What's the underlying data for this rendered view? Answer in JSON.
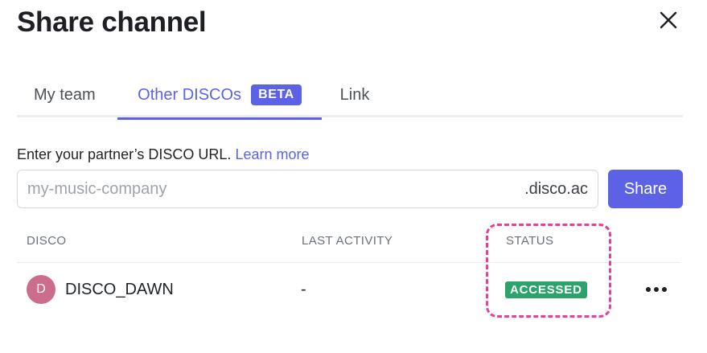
{
  "modal": {
    "title": "Share channel"
  },
  "tabs": [
    {
      "label": "My team",
      "active": false
    },
    {
      "label": "Other DISCOs",
      "badge": "BETA",
      "active": true
    },
    {
      "label": "Link",
      "active": false
    }
  ],
  "form": {
    "prompt": "Enter your partner’s DISCO URL.",
    "learn_more": "Learn more",
    "placeholder": "my-music-company",
    "value": "",
    "suffix": ".disco.ac",
    "share_label": "Share"
  },
  "table": {
    "headers": [
      "DISCO",
      "LAST ACTIVITY",
      "STATUS"
    ],
    "rows": [
      {
        "avatar_initial": "D",
        "avatar_color": "#cc6d8e",
        "disco": "DISCO_DAWN",
        "last_activity": "-",
        "status": "ACCESSED",
        "status_color": "#2ca36b"
      }
    ]
  },
  "icons": {
    "close": "close-icon",
    "more": "more-horizontal-icon"
  },
  "colors": {
    "accent": "#5b62e6",
    "success": "#2ca36b",
    "highlight": "#e0449a"
  }
}
